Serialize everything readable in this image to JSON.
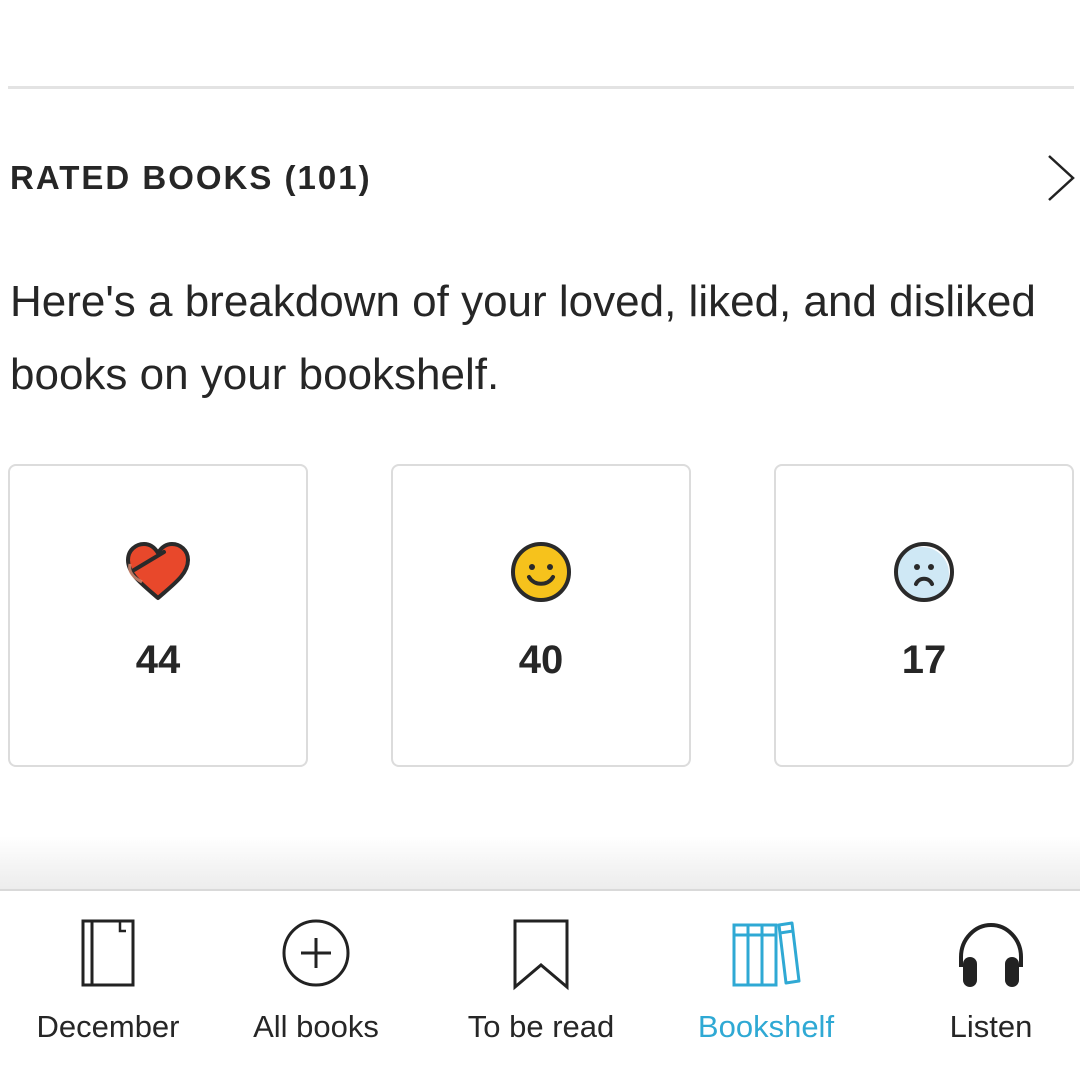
{
  "section": {
    "title": "RATED BOOKS (101)",
    "description": "Here's a breakdown of your loved, liked, and disliked books on your bookshelf."
  },
  "ratings": [
    {
      "icon": "heart-icon",
      "count": "44",
      "color": "#e8482b"
    },
    {
      "icon": "smiley-icon",
      "count": "40",
      "color": "#f6c21c"
    },
    {
      "icon": "frown-icon",
      "count": "17",
      "color": "#cfe8f5"
    }
  ],
  "tabs": [
    {
      "label": "December",
      "icon": "notebook-icon",
      "active": false
    },
    {
      "label": "All books",
      "icon": "plus-circle-icon",
      "active": false
    },
    {
      "label": "To be read",
      "icon": "bookmark-icon",
      "active": false
    },
    {
      "label": "Bookshelf",
      "icon": "bookshelf-icon",
      "active": true
    },
    {
      "label": "Listen",
      "icon": "headphones-icon",
      "active": false
    }
  ],
  "colors": {
    "accent": "#2fa9d4",
    "text": "#262626",
    "divider": "#e3e3e3"
  }
}
